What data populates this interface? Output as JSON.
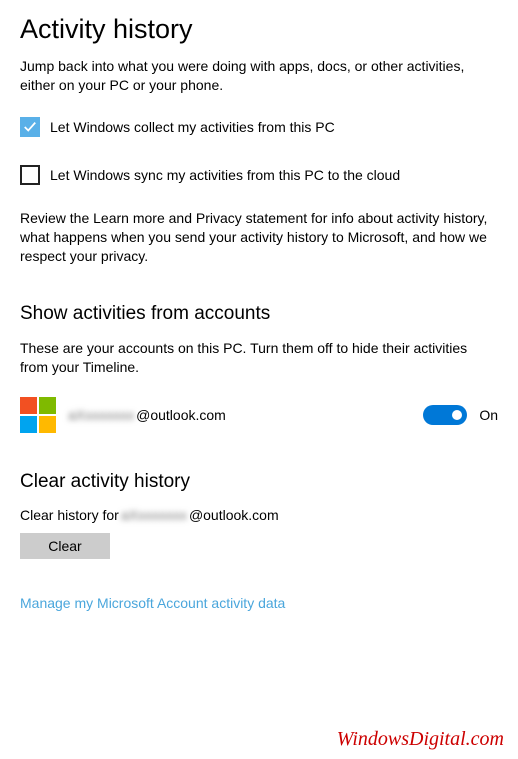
{
  "page": {
    "title": "Activity history",
    "intro": "Jump back into what you were doing with apps, docs, or other activities, either on your PC or your phone."
  },
  "checkboxes": [
    {
      "label": "Let Windows collect my activities from this PC",
      "checked": true
    },
    {
      "label": "Let Windows sync my activities from this PC to the cloud",
      "checked": false
    }
  ],
  "privacy_note": "Review the Learn more and Privacy statement for info about activity history, what happens when you send your activity history to Microsoft, and how we respect your privacy.",
  "accounts": {
    "heading": "Show activities from accounts",
    "desc": "These are your accounts on this PC. Turn them off to hide their activities from your Timeline.",
    "item": {
      "email_prefix_obscured": "aXxxxxxxx",
      "email_suffix": "@outlook.com",
      "toggle_state": "On"
    }
  },
  "clear": {
    "heading": "Clear activity history",
    "desc_prefix": "Clear history for ",
    "email_prefix_obscured": "aXxxxxxxx",
    "email_suffix": "@outlook.com",
    "button": "Clear"
  },
  "manage_link": "Manage my Microsoft Account activity data",
  "watermark": "WindowsDigital.com"
}
